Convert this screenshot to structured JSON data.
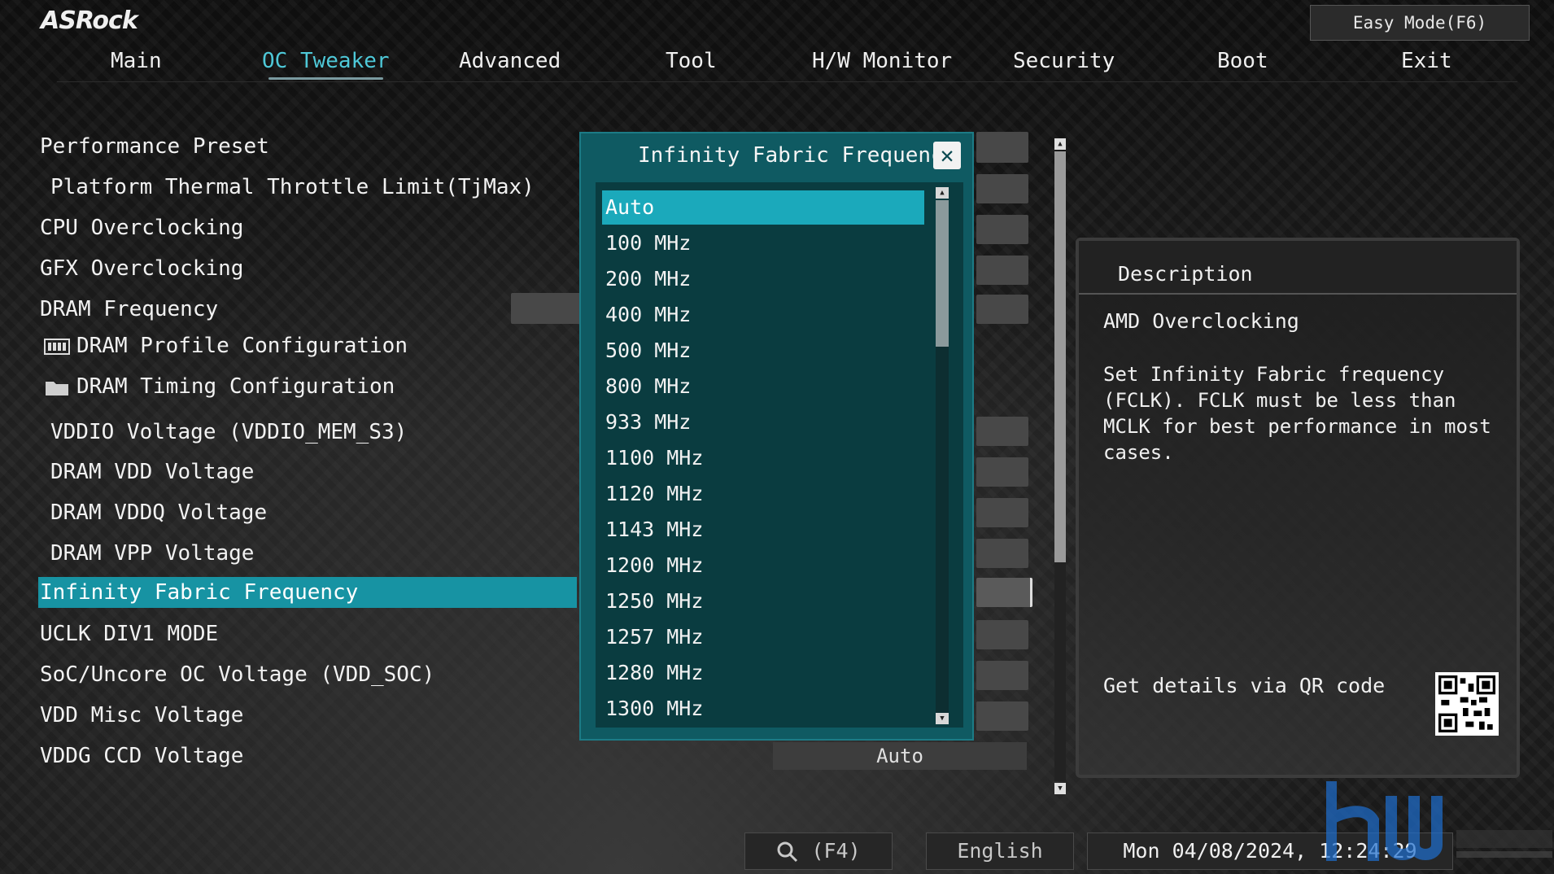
{
  "brand": {
    "logo": "ASRock"
  },
  "header": {
    "easy_mode": "Easy Mode(F6)"
  },
  "nav": {
    "tabs": [
      {
        "label": "Main"
      },
      {
        "label": "OC Tweaker"
      },
      {
        "label": "Advanced"
      },
      {
        "label": "Tool"
      },
      {
        "label": "H/W Monitor"
      },
      {
        "label": "Security"
      },
      {
        "label": "Boot"
      },
      {
        "label": "Exit"
      }
    ],
    "active_tab": "OC Tweaker"
  },
  "menu": {
    "items": [
      {
        "label": "Performance Preset"
      },
      {
        "label": "Platform Thermal Throttle Limit(TjMax)"
      },
      {
        "label": "CPU Overclocking"
      },
      {
        "label": "GFX Overclocking"
      },
      {
        "label": "DRAM Frequency"
      },
      {
        "label": "DRAM Profile Configuration",
        "icon": "memory-module-icon"
      },
      {
        "label": "DRAM Timing Configuration",
        "icon": "folder-icon"
      },
      {
        "label": "VDDIO Voltage (VDDIO_MEM_S3)"
      },
      {
        "label": "DRAM VDD Voltage"
      },
      {
        "label": "DRAM VDDQ Voltage"
      },
      {
        "label": "DRAM VPP Voltage"
      },
      {
        "label": "Infinity Fabric Frequency",
        "selected": true
      },
      {
        "label": "UCLK DIV1 MODE"
      },
      {
        "label": "SoC/Uncore OC Voltage (VDD_SOC)"
      },
      {
        "label": "VDD Misc Voltage"
      },
      {
        "label": "VDDG CCD Voltage"
      }
    ],
    "last_value": "Auto"
  },
  "popup": {
    "title": "Infinity Fabric Frequency",
    "close_icon": "close-icon",
    "options": [
      "Auto",
      "100 MHz",
      "200 MHz",
      "400 MHz",
      "500 MHz",
      "800 MHz",
      "933 MHz",
      "1100 MHz",
      "1120 MHz",
      "1143 MHz",
      "1200 MHz",
      "1250 MHz",
      "1257 MHz",
      "1280 MHz",
      "1300 MHz"
    ],
    "selected": "Auto"
  },
  "description": {
    "title": "Description",
    "heading": "AMD Overclocking",
    "body": "Set Infinity Fabric frequency (FCLK). FCLK must be less than MCLK for best performance in most cases.",
    "qr_label": "Get details via QR code"
  },
  "footer": {
    "search": "(F4)",
    "search_icon": "search-icon",
    "language": "English",
    "datetime": "Mon 04/08/2024, 12:24:29"
  },
  "colors": {
    "accent": "#1793a3",
    "popup_bg": "#0f5a62",
    "option_selected": "#1ba9bb",
    "active_tab": "#4ec8d8"
  }
}
